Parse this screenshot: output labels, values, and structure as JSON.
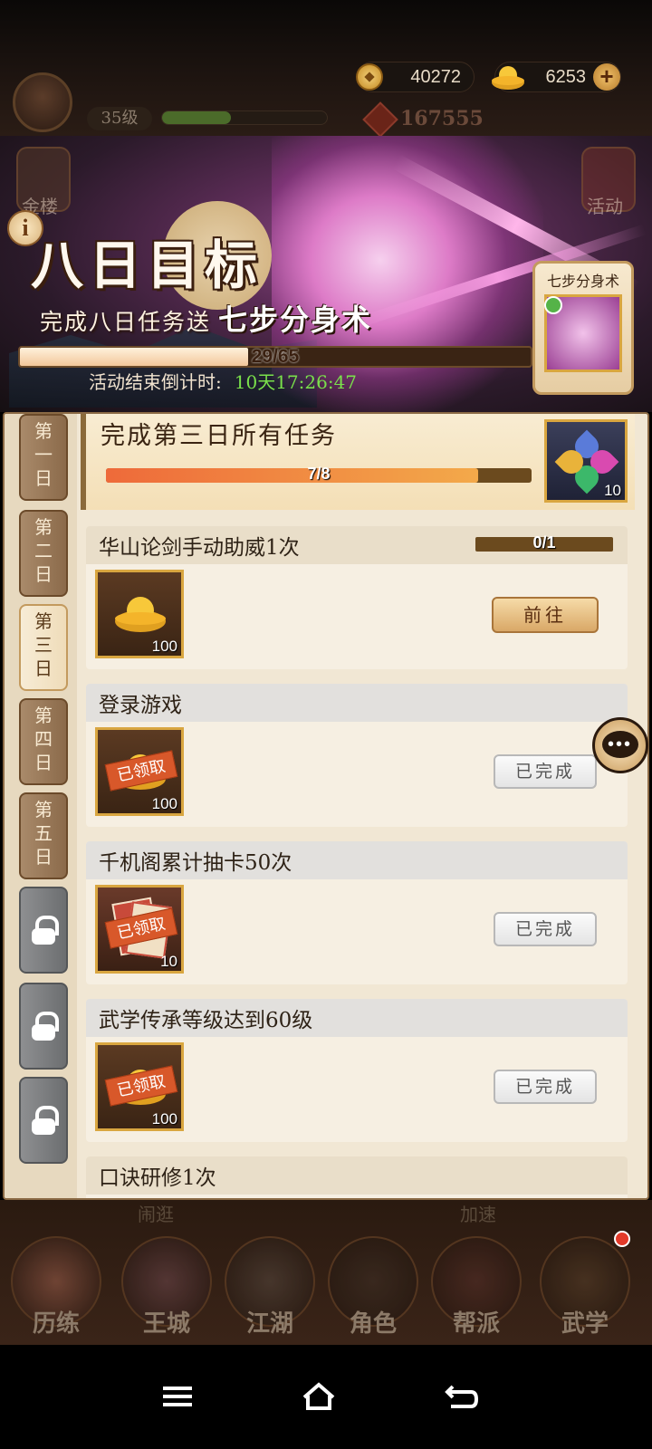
{
  "header": {
    "level": "35级",
    "power": "167555",
    "coins": "40272",
    "gold": "6253",
    "plus_label": "+",
    "left_icon_label": "金楼",
    "right_icon_label": "活动"
  },
  "banner": {
    "title": "八日目标",
    "subtitle_prefix": "完成八日任务送",
    "subtitle_reward": "七步分身术",
    "progress_text": "29/65",
    "progress_value": 0.446,
    "countdown_label": "活动结束倒计时:",
    "countdown_value": "10天17:26:47",
    "reward_card_label": "七步分身术"
  },
  "day_tabs": [
    {
      "label": "第一日",
      "chars": [
        "第",
        "一",
        "日"
      ],
      "state": "normal"
    },
    {
      "label": "第二日",
      "chars": [
        "第",
        "二",
        "日"
      ],
      "state": "normal"
    },
    {
      "label": "第三日",
      "chars": [
        "第",
        "三",
        "日"
      ],
      "state": "active"
    },
    {
      "label": "第四日",
      "chars": [
        "第",
        "四",
        "日"
      ],
      "state": "normal"
    },
    {
      "label": "第五日",
      "chars": [
        "第",
        "五",
        "日"
      ],
      "state": "normal"
    },
    {
      "state": "locked"
    },
    {
      "state": "locked"
    },
    {
      "state": "locked"
    }
  ],
  "summary_task": {
    "title": "完成第三日所有任务",
    "progress_text": "7/8",
    "progress_value": 0.875,
    "reward_qty": "10"
  },
  "tasks": [
    {
      "title": "华山论剑手动助威1次",
      "progress_text": "0/1",
      "reward_qty": "100",
      "action": "前往",
      "state": "pending"
    },
    {
      "title": "登录游戏",
      "reward_qty": "100",
      "stamp": "已领取",
      "action": "已完成",
      "state": "done"
    },
    {
      "title": "千机阁累计抽卡50次",
      "reward_qty": "10",
      "stamp": "已领取",
      "action": "已完成",
      "state": "done"
    },
    {
      "title": "武学传承等级达到60级",
      "reward_qty": "100",
      "stamp": "已领取",
      "action": "已完成",
      "state": "done"
    },
    {
      "title": "口诀研修1次",
      "state": "partial"
    }
  ],
  "bottom_nav": [
    {
      "label": "历练"
    },
    {
      "label": "王城"
    },
    {
      "label": "江湖"
    },
    {
      "label": "角色"
    },
    {
      "label": "帮派"
    },
    {
      "label": "武学"
    }
  ],
  "bottom_ghost": {
    "left": "闹逛",
    "right": "加速"
  },
  "colors": {
    "accent_orange": "#ee6a3a",
    "gold_border": "#d9a640",
    "countdown_green": "#7ae04b",
    "panel_bg": "#f1e7d4"
  }
}
